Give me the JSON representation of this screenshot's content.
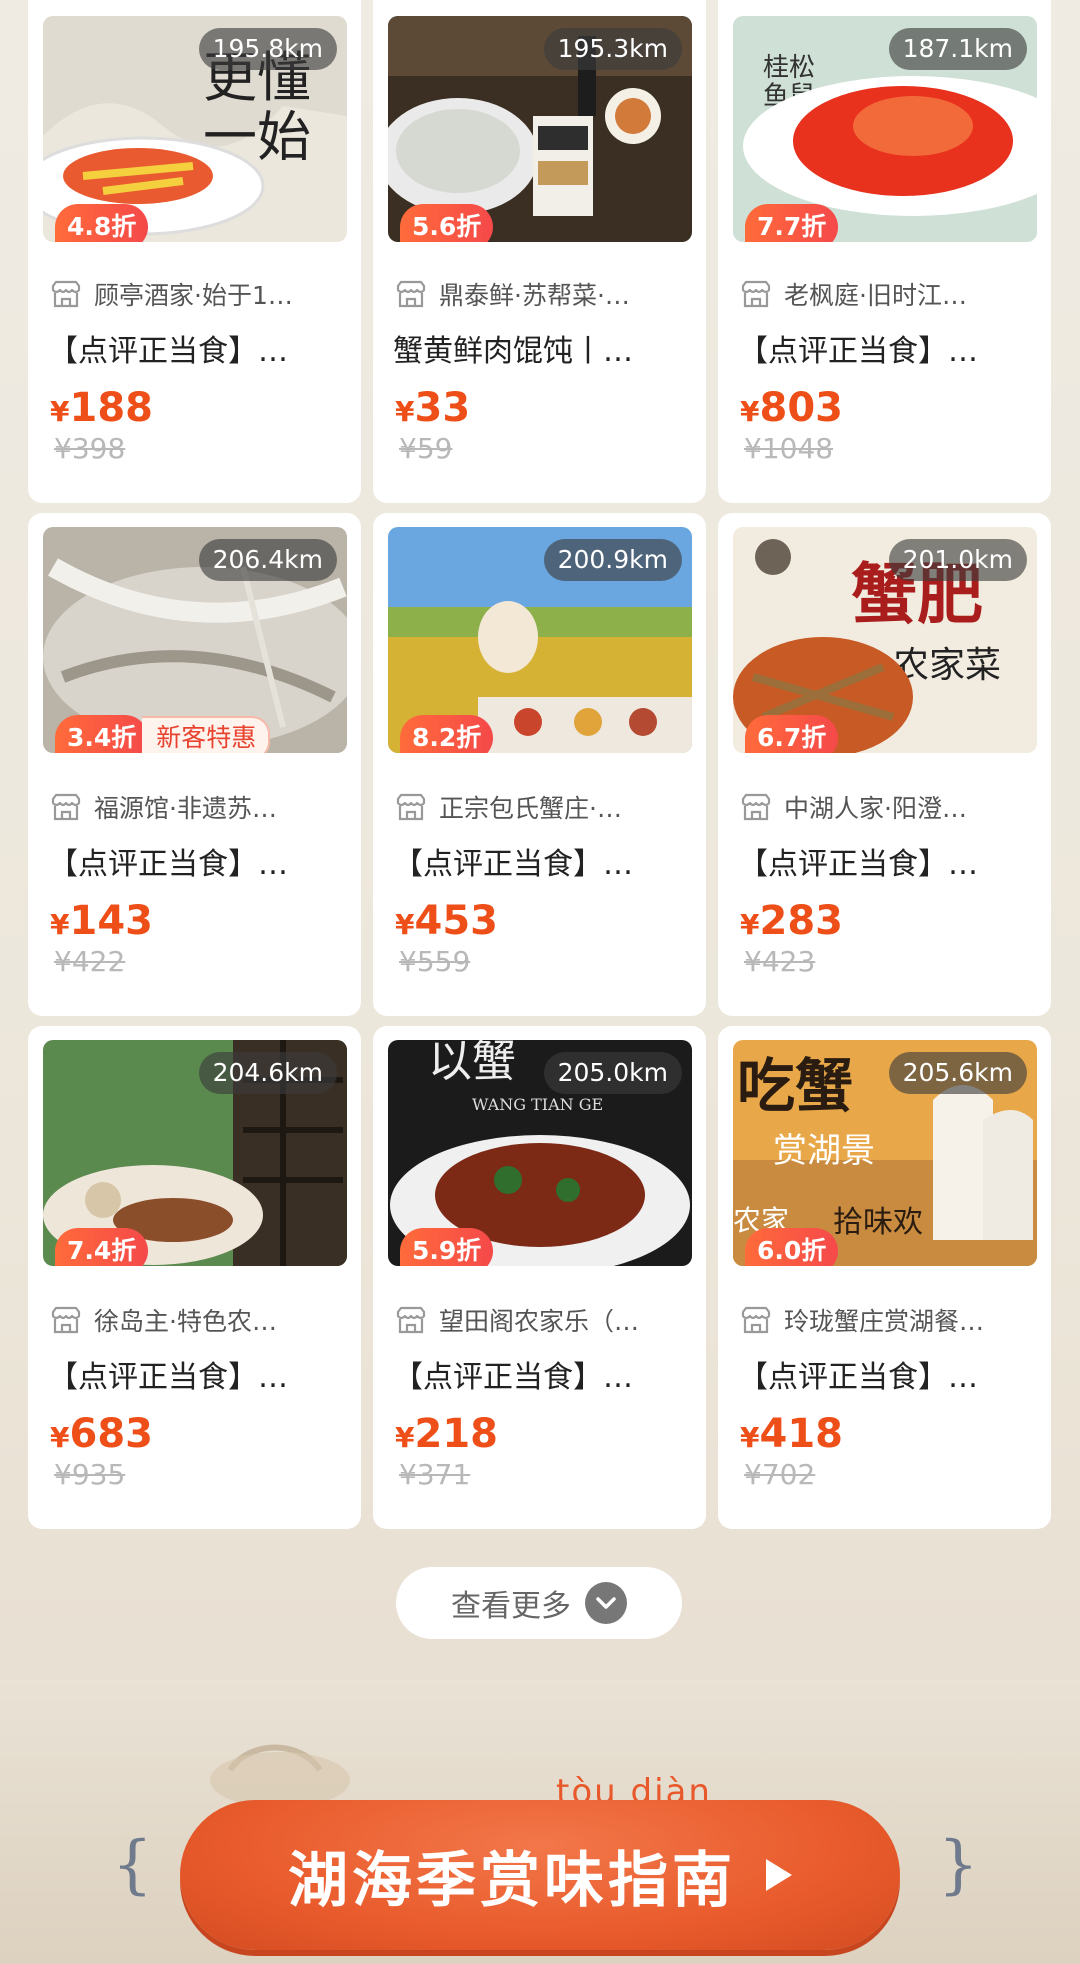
{
  "cards": [
    {
      "distance": "195.8km",
      "discount": "4.8折",
      "new_tag": "",
      "shop": "顾亭酒家·始于1…",
      "title": "【点评正当食】…",
      "price": "188",
      "orig": "¥398",
      "img": "a"
    },
    {
      "distance": "195.3km",
      "discount": "5.6折",
      "new_tag": "",
      "shop": "鼎泰鲜·苏帮菜·…",
      "title": "蟹黄鲜肉馄饨丨…",
      "price": "33",
      "orig": "¥59",
      "img": "b"
    },
    {
      "distance": "187.1km",
      "discount": "7.7折",
      "new_tag": "",
      "shop": "老枫庭·旧时江…",
      "title": "【点评正当食】…",
      "price": "803",
      "orig": "¥1048",
      "img": "c"
    },
    {
      "distance": "206.4km",
      "discount": "3.4折",
      "new_tag": "新客特惠",
      "shop": "福源馆·非遗苏…",
      "title": "【点评正当食】…",
      "price": "143",
      "orig": "¥422",
      "img": "d"
    },
    {
      "distance": "200.9km",
      "discount": "8.2折",
      "new_tag": "",
      "shop": "正宗包氏蟹庄·…",
      "title": "【点评正当食】…",
      "price": "453",
      "orig": "¥559",
      "img": "e"
    },
    {
      "distance": "201.0km",
      "discount": "6.7折",
      "new_tag": "",
      "shop": "中湖人家·阳澄…",
      "title": "【点评正当食】…",
      "price": "283",
      "orig": "¥423",
      "img": "f"
    },
    {
      "distance": "204.6km",
      "discount": "7.4折",
      "new_tag": "",
      "shop": "徐岛主·特色农…",
      "title": "【点评正当食】…",
      "price": "683",
      "orig": "¥935",
      "img": "g"
    },
    {
      "distance": "205.0km",
      "discount": "5.9折",
      "new_tag": "",
      "shop": "望田阁农家乐（…",
      "title": "【点评正当食】…",
      "price": "218",
      "orig": "¥371",
      "img": "h"
    },
    {
      "distance": "205.6km",
      "discount": "6.0折",
      "new_tag": "",
      "shop": "玲珑蟹庄赏湖餐…",
      "title": "【点评正当食】…",
      "price": "418",
      "orig": "¥702",
      "img": "i"
    }
  ],
  "currency": "¥",
  "image_texts": {
    "a": "更懂\n一始",
    "c": "桂松\n鱼鼠",
    "f_big": "蟹肥",
    "f_small": "农家菜",
    "h_big": "以蟹",
    "h_sub": "WANG TIAN GE",
    "i_big": "吃蟹",
    "i_mid": "赏湖景",
    "i_small": "拾味欢",
    "i_side": "农家"
  },
  "more_button": "查看更多",
  "banner": {
    "label": "湖海季赏味指南",
    "pinyin": "tòu diàn",
    "left_brace": "{",
    "right_brace": "}"
  },
  "colors": {
    "price": "#ee4e18",
    "discount": "#f5494a",
    "cta": "#e95b2c"
  }
}
